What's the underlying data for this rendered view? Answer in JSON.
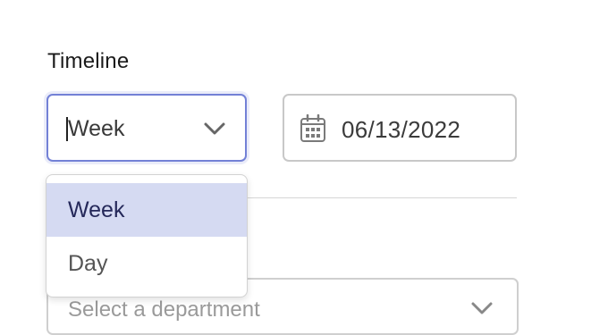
{
  "timeline": {
    "label": "Timeline",
    "select_value": "Week",
    "date_value": "06/13/2022",
    "options": [
      "Week",
      "Day"
    ],
    "selected_option": "Week"
  },
  "department": {
    "placeholder": "Select a department"
  },
  "colors": {
    "focus_border": "#7381d6",
    "selected_option_bg": "#d5daf2",
    "border": "#c8c8c8"
  },
  "icons": {
    "select_chevron": "chevron-down-icon",
    "date": "calendar-icon"
  }
}
